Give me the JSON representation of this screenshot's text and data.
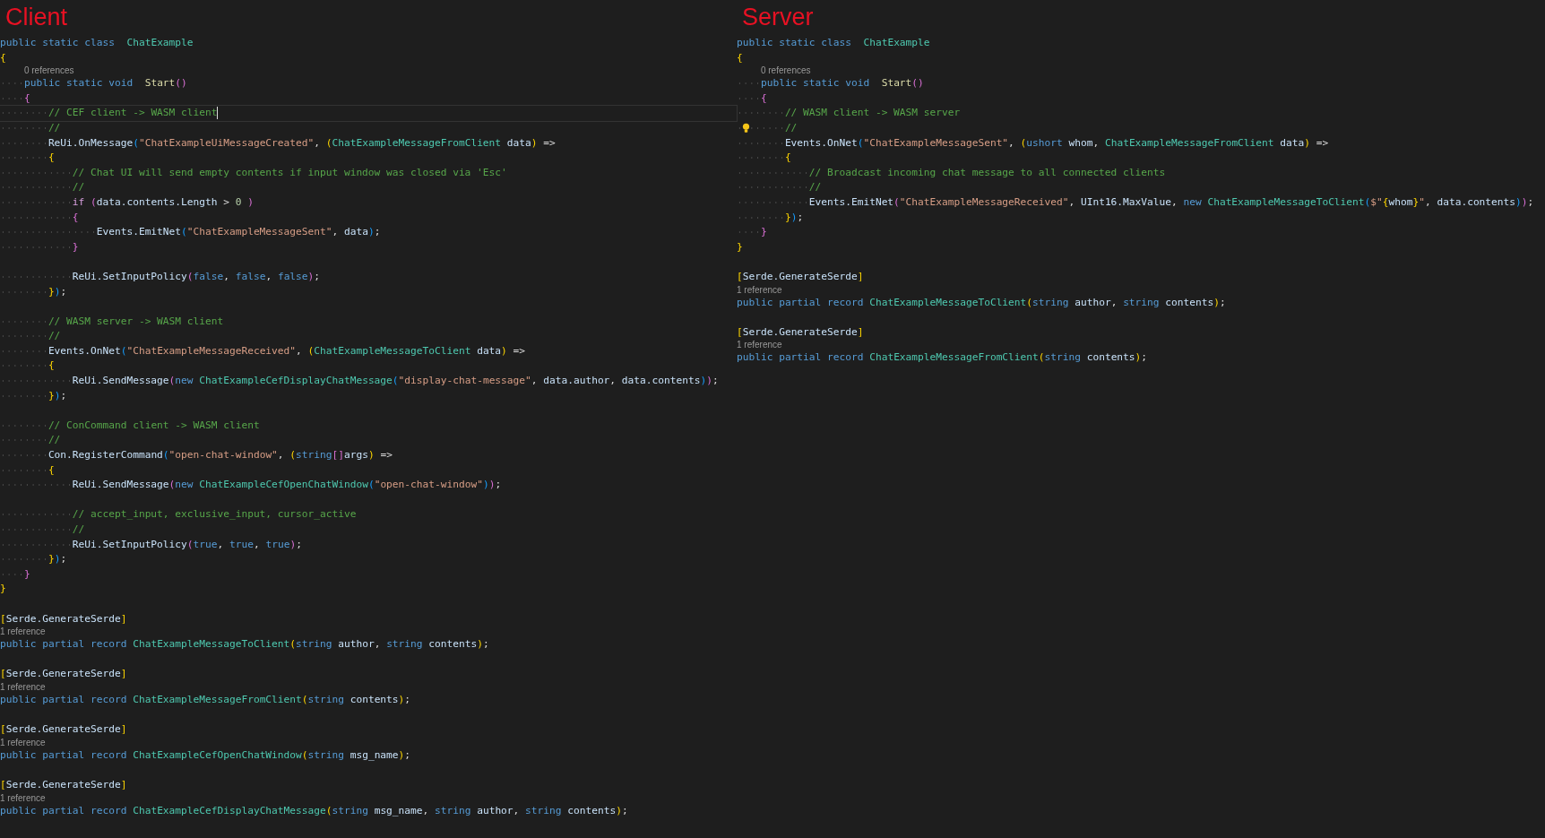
{
  "panels": [
    {
      "title": "Client",
      "lines": [
        {
          "kind": "code",
          "tokens": [
            {
              "t": "public static class ",
              "kind": "kw"
            },
            {
              "t": "ChatExample",
              "kind": "ty"
            }
          ]
        },
        {
          "kind": "code",
          "tokens": [
            {
              "t": "{",
              "kind": "b1"
            }
          ]
        },
        {
          "kind": "lens",
          "tokens": [
            {
              "kind": "gap"
            },
            {
              "t": "0 references",
              "kind": "lens"
            }
          ]
        },
        {
          "kind": "code",
          "tokens": [
            {
              "kind": "tab"
            },
            {
              "t": "public static void ",
              "kind": "kw"
            },
            {
              "t": "Start",
              "kind": "fn"
            },
            {
              "t": "()",
              "kind": "b2"
            }
          ]
        },
        {
          "kind": "code",
          "tokens": [
            {
              "kind": "tab"
            },
            {
              "t": "{",
              "kind": "b2"
            }
          ]
        },
        {
          "kind": "code",
          "cursor": true,
          "tokens": [
            {
              "kind": "tab"
            },
            {
              "kind": "tab"
            },
            {
              "t": "// CEF client -> WASM client",
              "kind": "cm"
            }
          ]
        },
        {
          "kind": "code",
          "tokens": [
            {
              "kind": "tab"
            },
            {
              "kind": "tab"
            },
            {
              "t": "//",
              "kind": "cm"
            }
          ]
        },
        {
          "kind": "code",
          "tokens": [
            {
              "kind": "tab"
            },
            {
              "kind": "tab"
            },
            {
              "t": "ReUi.OnMessage",
              "kind": "id"
            },
            {
              "t": "(",
              "kind": "b3"
            },
            {
              "t": "\"ChatExampleUiMessageCreated\"",
              "kind": "st"
            },
            {
              "t": ",",
              "kind": "p"
            },
            {
              "t": "(",
              "kind": "b1"
            },
            {
              "t": "ChatExampleMessageFromClient",
              "kind": "ty"
            },
            {
              "t": "data",
              "kind": "id"
            },
            {
              "t": ")",
              "kind": "b1"
            },
            {
              "t": "=>",
              "kind": "p"
            }
          ]
        },
        {
          "kind": "code",
          "tokens": [
            {
              "kind": "tab"
            },
            {
              "kind": "tab"
            },
            {
              "t": "{",
              "kind": "b1"
            }
          ]
        },
        {
          "kind": "code",
          "tokens": [
            {
              "kind": "tab"
            },
            {
              "kind": "tab"
            },
            {
              "kind": "tab"
            },
            {
              "t": "// Chat UI will send empty contents if input window was closed via 'Esc'",
              "kind": "cm"
            }
          ]
        },
        {
          "kind": "code",
          "tokens": [
            {
              "kind": "tab"
            },
            {
              "kind": "tab"
            },
            {
              "kind": "tab"
            },
            {
              "t": "//",
              "kind": "cm"
            }
          ]
        },
        {
          "kind": "code",
          "tokens": [
            {
              "kind": "tab"
            },
            {
              "kind": "tab"
            },
            {
              "kind": "tab"
            },
            {
              "t": "if",
              "kind": "ctl"
            },
            {
              "t": "(",
              "kind": "b2"
            },
            {
              "t": "data.contents.Length",
              "kind": "id"
            },
            {
              "t": ">",
              "kind": "p"
            },
            {
              "t": "0",
              "kind": "num"
            },
            {
              "t": ")",
              "kind": "b2"
            }
          ]
        },
        {
          "kind": "code",
          "tokens": [
            {
              "kind": "tab"
            },
            {
              "kind": "tab"
            },
            {
              "kind": "tab"
            },
            {
              "t": "{",
              "kind": "b2"
            }
          ]
        },
        {
          "kind": "code",
          "tokens": [
            {
              "kind": "tab"
            },
            {
              "kind": "tab"
            },
            {
              "kind": "tab"
            },
            {
              "kind": "tab"
            },
            {
              "t": "Events.EmitNet",
              "kind": "id"
            },
            {
              "t": "(",
              "kind": "b3"
            },
            {
              "t": "\"ChatExampleMessageSent\"",
              "kind": "st"
            },
            {
              "t": ",",
              "kind": "p"
            },
            {
              "t": "data",
              "kind": "id"
            },
            {
              "t": ")",
              "kind": "b3"
            },
            {
              "t": ";",
              "kind": "p"
            }
          ]
        },
        {
          "kind": "code",
          "tokens": [
            {
              "kind": "tab"
            },
            {
              "kind": "tab"
            },
            {
              "kind": "tab"
            },
            {
              "t": "}",
              "kind": "b2"
            }
          ]
        },
        {
          "kind": "blank"
        },
        {
          "kind": "code",
          "tokens": [
            {
              "kind": "tab"
            },
            {
              "kind": "tab"
            },
            {
              "kind": "tab"
            },
            {
              "t": "ReUi.SetInputPolicy",
              "kind": "id"
            },
            {
              "t": "(",
              "kind": "b2"
            },
            {
              "t": "false",
              "kind": "kw"
            },
            {
              "t": ",",
              "kind": "p"
            },
            {
              "t": "false",
              "kind": "kw"
            },
            {
              "t": ",",
              "kind": "p"
            },
            {
              "t": "false",
              "kind": "kw"
            },
            {
              "t": ")",
              "kind": "b2"
            },
            {
              "t": ";",
              "kind": "p"
            }
          ]
        },
        {
          "kind": "code",
          "tokens": [
            {
              "kind": "tab"
            },
            {
              "kind": "tab"
            },
            {
              "t": "}",
              "kind": "b1"
            },
            {
              "t": ")",
              "kind": "b3"
            },
            {
              "t": ";",
              "kind": "p"
            }
          ]
        },
        {
          "kind": "blank"
        },
        {
          "kind": "code",
          "tokens": [
            {
              "kind": "tab"
            },
            {
              "kind": "tab"
            },
            {
              "t": "// WASM server -> WASM client",
              "kind": "cm"
            }
          ]
        },
        {
          "kind": "code",
          "tokens": [
            {
              "kind": "tab"
            },
            {
              "kind": "tab"
            },
            {
              "t": "//",
              "kind": "cm"
            }
          ]
        },
        {
          "kind": "code",
          "tokens": [
            {
              "kind": "tab"
            },
            {
              "kind": "tab"
            },
            {
              "t": "Events.OnNet",
              "kind": "id"
            },
            {
              "t": "(",
              "kind": "b3"
            },
            {
              "t": "\"ChatExampleMessageReceived\"",
              "kind": "st"
            },
            {
              "t": ",",
              "kind": "p"
            },
            {
              "t": "(",
              "kind": "b1"
            },
            {
              "t": "ChatExampleMessageToClient",
              "kind": "ty"
            },
            {
              "t": "data",
              "kind": "id"
            },
            {
              "t": ")",
              "kind": "b1"
            },
            {
              "t": "=>",
              "kind": "p"
            }
          ]
        },
        {
          "kind": "code",
          "tokens": [
            {
              "kind": "tab"
            },
            {
              "kind": "tab"
            },
            {
              "t": "{",
              "kind": "b1"
            }
          ]
        },
        {
          "kind": "code",
          "tokens": [
            {
              "kind": "tab"
            },
            {
              "kind": "tab"
            },
            {
              "kind": "tab"
            },
            {
              "t": "ReUi.SendMessage",
              "kind": "id"
            },
            {
              "t": "(",
              "kind": "b2"
            },
            {
              "t": "new",
              "kind": "kw"
            },
            {
              "t": "ChatExampleCefDisplayChatMessage",
              "kind": "ty"
            },
            {
              "t": "(",
              "kind": "b3"
            },
            {
              "t": "\"display-chat-message\"",
              "kind": "st"
            },
            {
              "t": ",",
              "kind": "p"
            },
            {
              "t": "data.author",
              "kind": "id"
            },
            {
              "t": ",",
              "kind": "p"
            },
            {
              "t": "data.contents",
              "kind": "id"
            },
            {
              "t": ")",
              "kind": "b3"
            },
            {
              "t": ")",
              "kind": "b2"
            },
            {
              "t": ";",
              "kind": "p"
            }
          ]
        },
        {
          "kind": "code",
          "tokens": [
            {
              "kind": "tab"
            },
            {
              "kind": "tab"
            },
            {
              "t": "}",
              "kind": "b1"
            },
            {
              "t": ")",
              "kind": "b3"
            },
            {
              "t": ";",
              "kind": "p"
            }
          ]
        },
        {
          "kind": "blank"
        },
        {
          "kind": "code",
          "tokens": [
            {
              "kind": "tab"
            },
            {
              "kind": "tab"
            },
            {
              "t": "// ConCommand client -> WASM client",
              "kind": "cm"
            }
          ]
        },
        {
          "kind": "code",
          "tokens": [
            {
              "kind": "tab"
            },
            {
              "kind": "tab"
            },
            {
              "t": "//",
              "kind": "cm"
            }
          ]
        },
        {
          "kind": "code",
          "tokens": [
            {
              "kind": "tab"
            },
            {
              "kind": "tab"
            },
            {
              "t": "Con.RegisterCommand",
              "kind": "id"
            },
            {
              "t": "(",
              "kind": "b3"
            },
            {
              "t": "\"open-chat-window\"",
              "kind": "st"
            },
            {
              "t": ",",
              "kind": "p"
            },
            {
              "t": "(",
              "kind": "b1"
            },
            {
              "t": "string",
              "kind": "kw"
            },
            {
              "t": "[]",
              "kind": "b2"
            },
            {
              "t": "args",
              "kind": "id"
            },
            {
              "t": ")",
              "kind": "b1"
            },
            {
              "t": "=>",
              "kind": "p"
            }
          ]
        },
        {
          "kind": "code",
          "tokens": [
            {
              "kind": "tab"
            },
            {
              "kind": "tab"
            },
            {
              "t": "{",
              "kind": "b1"
            }
          ]
        },
        {
          "kind": "code",
          "tokens": [
            {
              "kind": "tab"
            },
            {
              "kind": "tab"
            },
            {
              "kind": "tab"
            },
            {
              "t": "ReUi.SendMessage",
              "kind": "id"
            },
            {
              "t": "(",
              "kind": "b2"
            },
            {
              "t": "new",
              "kind": "kw"
            },
            {
              "t": "ChatExampleCefOpenChatWindow",
              "kind": "ty"
            },
            {
              "t": "(",
              "kind": "b3"
            },
            {
              "t": "\"open-chat-window\"",
              "kind": "st"
            },
            {
              "t": ")",
              "kind": "b3"
            },
            {
              "t": ")",
              "kind": "b2"
            },
            {
              "t": ";",
              "kind": "p"
            }
          ]
        },
        {
          "kind": "blank"
        },
        {
          "kind": "code",
          "tokens": [
            {
              "kind": "tab"
            },
            {
              "kind": "tab"
            },
            {
              "kind": "tab"
            },
            {
              "t": "// accept_input, exclusive_input, cursor_active",
              "kind": "cm"
            }
          ]
        },
        {
          "kind": "code",
          "tokens": [
            {
              "kind": "tab"
            },
            {
              "kind": "tab"
            },
            {
              "kind": "tab"
            },
            {
              "t": "//",
              "kind": "cm"
            }
          ]
        },
        {
          "kind": "code",
          "tokens": [
            {
              "kind": "tab"
            },
            {
              "kind": "tab"
            },
            {
              "kind": "tab"
            },
            {
              "t": "ReUi.SetInputPolicy",
              "kind": "id"
            },
            {
              "t": "(",
              "kind": "b2"
            },
            {
              "t": "true",
              "kind": "kw"
            },
            {
              "t": ",",
              "kind": "p"
            },
            {
              "t": "true",
              "kind": "kw"
            },
            {
              "t": ",",
              "kind": "p"
            },
            {
              "t": "true",
              "kind": "kw"
            },
            {
              "t": ")",
              "kind": "b2"
            },
            {
              "t": ";",
              "kind": "p"
            }
          ]
        },
        {
          "kind": "code",
          "tokens": [
            {
              "kind": "tab"
            },
            {
              "kind": "tab"
            },
            {
              "t": "}",
              "kind": "b1"
            },
            {
              "t": ")",
              "kind": "b3"
            },
            {
              "t": ";",
              "kind": "p"
            }
          ]
        },
        {
          "kind": "code",
          "tokens": [
            {
              "kind": "tab"
            },
            {
              "t": "}",
              "kind": "b2"
            }
          ]
        },
        {
          "kind": "code",
          "tokens": [
            {
              "t": "}",
              "kind": "b1"
            }
          ]
        },
        {
          "kind": "blank"
        },
        {
          "kind": "code",
          "tokens": [
            {
              "t": "[",
              "kind": "b1"
            },
            {
              "t": "Serde.GenerateSerde",
              "kind": "id"
            },
            {
              "t": "]",
              "kind": "b1"
            }
          ]
        },
        {
          "kind": "lens",
          "tokens": [
            {
              "t": "1 reference",
              "kind": "lens"
            }
          ]
        },
        {
          "kind": "code",
          "tokens": [
            {
              "t": "public partial record",
              "kind": "kw"
            },
            {
              "t": "ChatExampleMessageToClient",
              "kind": "ty"
            },
            {
              "t": "(",
              "kind": "b1"
            },
            {
              "t": "string",
              "kind": "kw"
            },
            {
              "t": "author",
              "kind": "id"
            },
            {
              "t": ",",
              "kind": "p"
            },
            {
              "t": "string",
              "kind": "kw"
            },
            {
              "t": "contents",
              "kind": "id"
            },
            {
              "t": ")",
              "kind": "b1"
            },
            {
              "t": ";",
              "kind": "p"
            }
          ]
        },
        {
          "kind": "blank"
        },
        {
          "kind": "code",
          "tokens": [
            {
              "t": "[",
              "kind": "b1"
            },
            {
              "t": "Serde.GenerateSerde",
              "kind": "id"
            },
            {
              "t": "]",
              "kind": "b1"
            }
          ]
        },
        {
          "kind": "lens",
          "tokens": [
            {
              "t": "1 reference",
              "kind": "lens"
            }
          ]
        },
        {
          "kind": "code",
          "tokens": [
            {
              "t": "public partial record",
              "kind": "kw"
            },
            {
              "t": "ChatExampleMessageFromClient",
              "kind": "ty"
            },
            {
              "t": "(",
              "kind": "b1"
            },
            {
              "t": "string",
              "kind": "kw"
            },
            {
              "t": "contents",
              "kind": "id"
            },
            {
              "t": ")",
              "kind": "b1"
            },
            {
              "t": ";",
              "kind": "p"
            }
          ]
        },
        {
          "kind": "blank"
        },
        {
          "kind": "code",
          "tokens": [
            {
              "t": "[",
              "kind": "b1"
            },
            {
              "t": "Serde.GenerateSerde",
              "kind": "id"
            },
            {
              "t": "]",
              "kind": "b1"
            }
          ]
        },
        {
          "kind": "lens",
          "tokens": [
            {
              "t": "1 reference",
              "kind": "lens"
            }
          ]
        },
        {
          "kind": "code",
          "tokens": [
            {
              "t": "public partial record",
              "kind": "kw"
            },
            {
              "t": "ChatExampleCefOpenChatWindow",
              "kind": "ty"
            },
            {
              "t": "(",
              "kind": "b1"
            },
            {
              "t": "string",
              "kind": "kw"
            },
            {
              "t": "msg_name",
              "kind": "id"
            },
            {
              "t": ")",
              "kind": "b1"
            },
            {
              "t": ";",
              "kind": "p"
            }
          ]
        },
        {
          "kind": "blank"
        },
        {
          "kind": "code",
          "tokens": [
            {
              "t": "[",
              "kind": "b1"
            },
            {
              "t": "Serde.GenerateSerde",
              "kind": "id"
            },
            {
              "t": "]",
              "kind": "b1"
            }
          ]
        },
        {
          "kind": "lens",
          "tokens": [
            {
              "t": "1 reference",
              "kind": "lens"
            }
          ]
        },
        {
          "kind": "code",
          "tokens": [
            {
              "t": "public partial record",
              "kind": "kw"
            },
            {
              "t": "ChatExampleCefDisplayChatMessage",
              "kind": "ty"
            },
            {
              "t": "(",
              "kind": "b1"
            },
            {
              "t": "string",
              "kind": "kw"
            },
            {
              "t": "msg_name",
              "kind": "id"
            },
            {
              "t": ",",
              "kind": "p"
            },
            {
              "t": "string",
              "kind": "kw"
            },
            {
              "t": "author",
              "kind": "id"
            },
            {
              "t": ",",
              "kind": "p"
            },
            {
              "t": "string",
              "kind": "kw"
            },
            {
              "t": "contents",
              "kind": "id"
            },
            {
              "t": ")",
              "kind": "b1"
            },
            {
              "t": ";",
              "kind": "p"
            }
          ]
        }
      ]
    },
    {
      "title": "Server",
      "lines": [
        {
          "kind": "code",
          "tokens": [
            {
              "t": "public static class ",
              "kind": "kw"
            },
            {
              "t": "ChatExample",
              "kind": "ty"
            }
          ]
        },
        {
          "kind": "code",
          "tokens": [
            {
              "t": "{",
              "kind": "b1"
            }
          ]
        },
        {
          "kind": "lens",
          "tokens": [
            {
              "kind": "gap"
            },
            {
              "t": "0 references",
              "kind": "lens"
            }
          ]
        },
        {
          "kind": "code",
          "tokens": [
            {
              "kind": "tab"
            },
            {
              "t": "public static void ",
              "kind": "kw"
            },
            {
              "t": "Start",
              "kind": "fn"
            },
            {
              "t": "()",
              "kind": "b2"
            }
          ]
        },
        {
          "kind": "code",
          "tokens": [
            {
              "kind": "tab"
            },
            {
              "t": "{",
              "kind": "b2"
            }
          ]
        },
        {
          "kind": "code",
          "tokens": [
            {
              "kind": "tab"
            },
            {
              "kind": "tab"
            },
            {
              "t": "// WASM client -> WASM server",
              "kind": "cm"
            }
          ]
        },
        {
          "kind": "code",
          "bulb": true,
          "tokens": [
            {
              "kind": "tab"
            },
            {
              "kind": "tab"
            },
            {
              "t": "//",
              "kind": "cm"
            }
          ]
        },
        {
          "kind": "code",
          "tokens": [
            {
              "kind": "tab"
            },
            {
              "kind": "tab"
            },
            {
              "t": "Events.OnNet",
              "kind": "id"
            },
            {
              "t": "(",
              "kind": "b3"
            },
            {
              "t": "\"ChatExampleMessageSent\"",
              "kind": "st"
            },
            {
              "t": ",",
              "kind": "p"
            },
            {
              "t": "(",
              "kind": "b1"
            },
            {
              "t": "ushort",
              "kind": "kw"
            },
            {
              "t": "whom",
              "kind": "id"
            },
            {
              "t": ",",
              "kind": "p"
            },
            {
              "t": "ChatExampleMessageFromClient",
              "kind": "ty"
            },
            {
              "t": "data",
              "kind": "id"
            },
            {
              "t": ")",
              "kind": "b1"
            },
            {
              "t": "=>",
              "kind": "p"
            }
          ]
        },
        {
          "kind": "code",
          "tokens": [
            {
              "kind": "tab"
            },
            {
              "kind": "tab"
            },
            {
              "t": "{",
              "kind": "b1"
            }
          ]
        },
        {
          "kind": "code",
          "tokens": [
            {
              "kind": "tab"
            },
            {
              "kind": "tab"
            },
            {
              "kind": "tab"
            },
            {
              "t": "// Broadcast incoming chat message to all connected clients",
              "kind": "cm"
            }
          ]
        },
        {
          "kind": "code",
          "tokens": [
            {
              "kind": "tab"
            },
            {
              "kind": "tab"
            },
            {
              "kind": "tab"
            },
            {
              "t": "//",
              "kind": "cm"
            }
          ]
        },
        {
          "kind": "code",
          "tokens": [
            {
              "kind": "tab"
            },
            {
              "kind": "tab"
            },
            {
              "kind": "tab"
            },
            {
              "t": "Events.EmitNet",
              "kind": "id"
            },
            {
              "t": "(",
              "kind": "b2"
            },
            {
              "t": "\"ChatExampleMessageReceived\"",
              "kind": "st"
            },
            {
              "t": ",",
              "kind": "p"
            },
            {
              "t": "UInt16.MaxValue",
              "kind": "id"
            },
            {
              "t": ",",
              "kind": "p"
            },
            {
              "t": "new",
              "kind": "kw"
            },
            {
              "t": "ChatExampleMessageToClient",
              "kind": "ty"
            },
            {
              "t": "(",
              "kind": "b3"
            },
            {
              "t": "$\"",
              "kind": "st"
            },
            {
              "t": "{",
              "kind": "b1"
            },
            {
              "t": "whom",
              "kind": "id"
            },
            {
              "t": "}",
              "kind": "b1"
            },
            {
              "t": "\"",
              "kind": "st"
            },
            {
              "t": ",",
              "kind": "p"
            },
            {
              "t": "data.contents",
              "kind": "id"
            },
            {
              "t": ")",
              "kind": "b3"
            },
            {
              "t": ")",
              "kind": "b2"
            },
            {
              "t": ";",
              "kind": "p"
            }
          ]
        },
        {
          "kind": "code",
          "tokens": [
            {
              "kind": "tab"
            },
            {
              "kind": "tab"
            },
            {
              "t": "}",
              "kind": "b1"
            },
            {
              "t": ")",
              "kind": "b3"
            },
            {
              "t": ";",
              "kind": "p"
            }
          ]
        },
        {
          "kind": "code",
          "tokens": [
            {
              "kind": "tab"
            },
            {
              "t": "}",
              "kind": "b2"
            }
          ]
        },
        {
          "kind": "code",
          "tokens": [
            {
              "t": "}",
              "kind": "b1"
            }
          ]
        },
        {
          "kind": "blank"
        },
        {
          "kind": "code",
          "tokens": [
            {
              "t": "[",
              "kind": "b1"
            },
            {
              "t": "Serde.GenerateSerde",
              "kind": "id"
            },
            {
              "t": "]",
              "kind": "b1"
            }
          ]
        },
        {
          "kind": "lens",
          "tokens": [
            {
              "t": "1 reference",
              "kind": "lens"
            }
          ]
        },
        {
          "kind": "code",
          "tokens": [
            {
              "t": "public partial record",
              "kind": "kw"
            },
            {
              "t": "ChatExampleMessageToClient",
              "kind": "ty"
            },
            {
              "t": "(",
              "kind": "b1"
            },
            {
              "t": "string",
              "kind": "kw"
            },
            {
              "t": "author",
              "kind": "id"
            },
            {
              "t": ",",
              "kind": "p"
            },
            {
              "t": "string",
              "kind": "kw"
            },
            {
              "t": "contents",
              "kind": "id"
            },
            {
              "t": ")",
              "kind": "b1"
            },
            {
              "t": ";",
              "kind": "p"
            }
          ]
        },
        {
          "kind": "blank"
        },
        {
          "kind": "code",
          "tokens": [
            {
              "t": "[",
              "kind": "b1"
            },
            {
              "t": "Serde.GenerateSerde",
              "kind": "id"
            },
            {
              "t": "]",
              "kind": "b1"
            }
          ]
        },
        {
          "kind": "lens",
          "tokens": [
            {
              "t": "1 reference",
              "kind": "lens"
            }
          ]
        },
        {
          "kind": "code",
          "tokens": [
            {
              "t": "public partial record",
              "kind": "kw"
            },
            {
              "t": "ChatExampleMessageFromClient",
              "kind": "ty"
            },
            {
              "t": "(",
              "kind": "b1"
            },
            {
              "t": "string",
              "kind": "kw"
            },
            {
              "t": "contents",
              "kind": "id"
            },
            {
              "t": ")",
              "kind": "b1"
            },
            {
              "t": ";",
              "kind": "p"
            }
          ]
        }
      ]
    }
  ]
}
